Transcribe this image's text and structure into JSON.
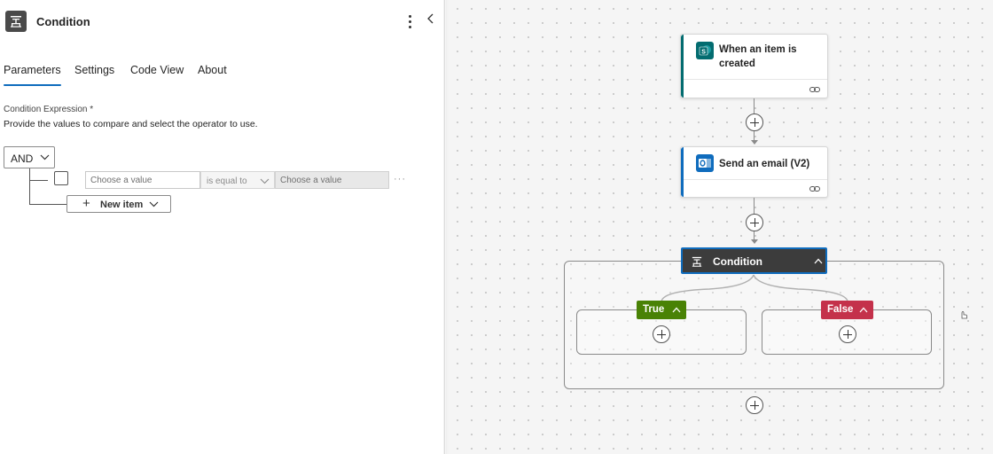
{
  "panel": {
    "title": "Condition",
    "tabs": [
      {
        "label": "Parameters",
        "active": true
      },
      {
        "label": "Settings",
        "active": false
      },
      {
        "label": "Code View",
        "active": false
      },
      {
        "label": "About",
        "active": false
      }
    ],
    "condition_label": "Condition Expression *",
    "condition_desc": "Provide the values to compare and select the operator to use.",
    "group_operator": "AND",
    "row": {
      "left_placeholder": "Choose a value",
      "operator": "is equal to",
      "right_placeholder": "Choose a value",
      "more": "···"
    },
    "new_item_label": "New item"
  },
  "flow": {
    "trigger": {
      "title": "When an item is created",
      "accent": "#036c70",
      "icon": "sharepoint-icon"
    },
    "action": {
      "title": "Send an email (V2)",
      "accent": "#0f6cbd",
      "icon": "outlook-icon"
    },
    "condition": {
      "title": "Condition"
    },
    "true_branch": {
      "label": "True",
      "color": "#498205"
    },
    "false_branch": {
      "label": "False",
      "color": "#c4314b"
    }
  },
  "colors": {
    "accent": "#0f6cbd",
    "canvas_bg": "#f5f5f5"
  }
}
